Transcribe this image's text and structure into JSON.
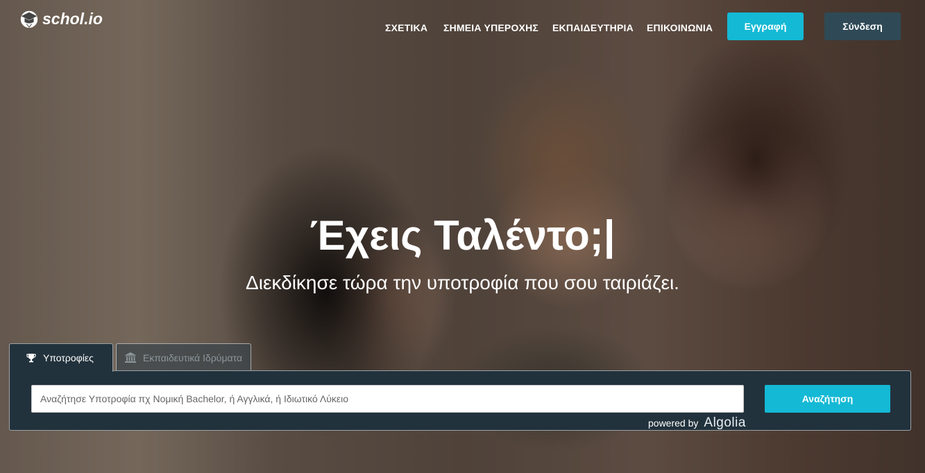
{
  "brand": {
    "name": "schol.io",
    "logo_icon": "graduation-cap-icon"
  },
  "nav": {
    "items": [
      {
        "label": "ΣΧΕΤΙΚΑ"
      },
      {
        "label": "ΣΗΜΕΙΑ ΥΠΕΡΟΧΗΣ"
      },
      {
        "label": "ΕΚΠΑΙΔΕΥΤΗΡΙΑ"
      },
      {
        "label": "ΕΠΙΚΟΙΝΩΝΙΑ"
      }
    ],
    "register_label": "Εγγραφή",
    "login_label": "Σύνδεση"
  },
  "hero": {
    "headline": "Έχεις Ταλέντο;|",
    "subheadline": "Διεκδίκησε τώρα την υποτροφία που σου ταιριάζει."
  },
  "search": {
    "tabs": [
      {
        "label": "Υποτροφίες",
        "icon": "trophy-icon",
        "active": true
      },
      {
        "label": "Εκπαιδευτικά Ιδρύματα",
        "icon": "institution-icon",
        "active": false
      }
    ],
    "placeholder": "Αναζήτησε Υποτροφία πχ Νομική Bachelor, ή Αγγλικά, ή Ιδιωτικό Λύκειο",
    "value": "",
    "button_label": "Αναζήτηση",
    "powered_by": "powered by",
    "provider": "Algolia"
  },
  "colors": {
    "accent": "#14b9d5",
    "login_button": "#2f4a56",
    "panel": "#22323c"
  }
}
